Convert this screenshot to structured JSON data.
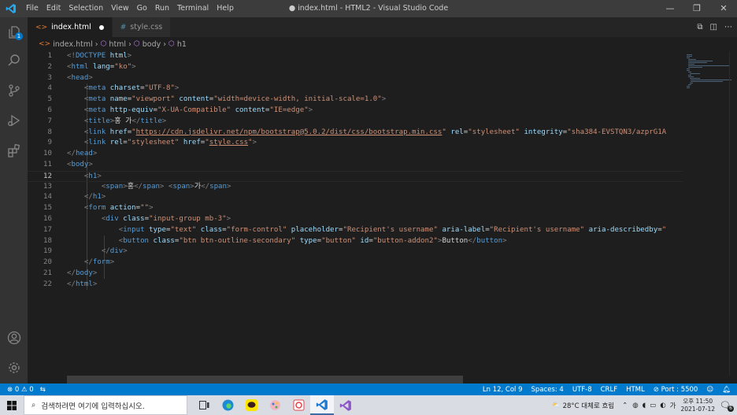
{
  "titlebar": {
    "menu": [
      "File",
      "Edit",
      "Selection",
      "View",
      "Go",
      "Run",
      "Terminal",
      "Help"
    ],
    "title": "● index.html - HTML2 - Visual Studio Code"
  },
  "activity": {
    "explorer_badge": "1"
  },
  "tabs": [
    {
      "label": "index.html",
      "icon": "<>",
      "modified": true,
      "active": true
    },
    {
      "label": "style.css",
      "icon": "#",
      "modified": false,
      "active": false
    }
  ],
  "breadcrumb": [
    "index.html",
    "html",
    "body",
    "h1"
  ],
  "editor": {
    "current_line": 12,
    "lines": [
      [
        [
          "t-br",
          "<!"
        ],
        [
          "t-tag",
          "DOCTYPE"
        ],
        [
          "t-txt",
          " "
        ],
        [
          "t-att",
          "html"
        ],
        [
          "t-br",
          ">"
        ]
      ],
      [
        [
          "t-br",
          "<"
        ],
        [
          "t-tag",
          "html"
        ],
        [
          "t-txt",
          " "
        ],
        [
          "t-att",
          "lang"
        ],
        [
          "t-txt",
          "="
        ],
        [
          "t-str",
          "\"ko\""
        ],
        [
          "t-br",
          ">"
        ]
      ],
      [
        [
          "t-br",
          "<"
        ],
        [
          "t-tag",
          "head"
        ],
        [
          "t-br",
          ">"
        ]
      ],
      [
        [
          "t-txt",
          "    "
        ],
        [
          "t-br",
          "<"
        ],
        [
          "t-tag",
          "meta"
        ],
        [
          "t-txt",
          " "
        ],
        [
          "t-att",
          "charset"
        ],
        [
          "t-txt",
          "="
        ],
        [
          "t-str",
          "\"UTF-8\""
        ],
        [
          "t-br",
          ">"
        ]
      ],
      [
        [
          "t-txt",
          "    "
        ],
        [
          "t-br",
          "<"
        ],
        [
          "t-tag",
          "meta"
        ],
        [
          "t-txt",
          " "
        ],
        [
          "t-att",
          "name"
        ],
        [
          "t-txt",
          "="
        ],
        [
          "t-str",
          "\"viewport\""
        ],
        [
          "t-txt",
          " "
        ],
        [
          "t-att",
          "content"
        ],
        [
          "t-txt",
          "="
        ],
        [
          "t-str",
          "\"width=device-width, initial-scale=1.0\""
        ],
        [
          "t-br",
          ">"
        ]
      ],
      [
        [
          "t-txt",
          "    "
        ],
        [
          "t-br",
          "<"
        ],
        [
          "t-tag",
          "meta"
        ],
        [
          "t-txt",
          " "
        ],
        [
          "t-att",
          "http-equiv"
        ],
        [
          "t-txt",
          "="
        ],
        [
          "t-str",
          "\"X-UA-Compatible\""
        ],
        [
          "t-txt",
          " "
        ],
        [
          "t-att",
          "content"
        ],
        [
          "t-txt",
          "="
        ],
        [
          "t-str",
          "\"IE=edge\""
        ],
        [
          "t-br",
          ">"
        ]
      ],
      [
        [
          "t-txt",
          "    "
        ],
        [
          "t-br",
          "<"
        ],
        [
          "t-tag",
          "title"
        ],
        [
          "t-br",
          ">"
        ],
        [
          "t-txt",
          "홍 가"
        ],
        [
          "t-br",
          "</"
        ],
        [
          "t-tag",
          "title"
        ],
        [
          "t-br",
          ">"
        ]
      ],
      [
        [
          "t-txt",
          "    "
        ],
        [
          "t-br",
          "<"
        ],
        [
          "t-tag",
          "link"
        ],
        [
          "t-txt",
          " "
        ],
        [
          "t-att",
          "href"
        ],
        [
          "t-txt",
          "="
        ],
        [
          "t-str",
          "\""
        ],
        [
          "t-link",
          "https://cdn.jsdelivr.net/npm/bootstrap@5.0.2/dist/css/bootstrap.min.css"
        ],
        [
          "t-str",
          "\""
        ],
        [
          "t-txt",
          " "
        ],
        [
          "t-att",
          "rel"
        ],
        [
          "t-txt",
          "="
        ],
        [
          "t-str",
          "\"stylesheet\""
        ],
        [
          "t-txt",
          " "
        ],
        [
          "t-att",
          "integrity"
        ],
        [
          "t-txt",
          "="
        ],
        [
          "t-str",
          "\"sha384-EVSTQN3/azprG1A"
        ]
      ],
      [
        [
          "t-txt",
          "    "
        ],
        [
          "t-br",
          "<"
        ],
        [
          "t-tag",
          "link"
        ],
        [
          "t-txt",
          " "
        ],
        [
          "t-att",
          "rel"
        ],
        [
          "t-txt",
          "="
        ],
        [
          "t-str",
          "\"stylesheet\""
        ],
        [
          "t-txt",
          " "
        ],
        [
          "t-att",
          "href"
        ],
        [
          "t-txt",
          "="
        ],
        [
          "t-str",
          "\""
        ],
        [
          "t-link",
          "style.css"
        ],
        [
          "t-str",
          "\""
        ],
        [
          "t-br",
          ">"
        ]
      ],
      [
        [
          "t-br",
          "</"
        ],
        [
          "t-tag",
          "head"
        ],
        [
          "t-br",
          ">"
        ]
      ],
      [
        [
          "t-br",
          "<"
        ],
        [
          "t-tag",
          "body"
        ],
        [
          "t-br",
          ">"
        ]
      ],
      [
        [
          "t-txt",
          "    "
        ],
        [
          "t-br",
          "<"
        ],
        [
          "t-tag",
          "h1"
        ],
        [
          "t-br",
          ">"
        ]
      ],
      [
        [
          "t-txt",
          "        "
        ],
        [
          "t-br",
          "<"
        ],
        [
          "t-tag",
          "span"
        ],
        [
          "t-br",
          ">"
        ],
        [
          "t-txt",
          "홍"
        ],
        [
          "t-br",
          "</"
        ],
        [
          "t-tag",
          "span"
        ],
        [
          "t-br",
          ">"
        ],
        [
          "t-txt",
          " "
        ],
        [
          "t-br",
          "<"
        ],
        [
          "t-tag",
          "span"
        ],
        [
          "t-br",
          ">"
        ],
        [
          "t-txt",
          "가"
        ],
        [
          "t-br",
          "</"
        ],
        [
          "t-tag",
          "span"
        ],
        [
          "t-br",
          ">"
        ]
      ],
      [
        [
          "t-txt",
          "    "
        ],
        [
          "t-br",
          "</"
        ],
        [
          "t-tag",
          "h1"
        ],
        [
          "t-br",
          ">"
        ]
      ],
      [
        [
          "t-txt",
          "    "
        ],
        [
          "t-br",
          "<"
        ],
        [
          "t-tag",
          "form"
        ],
        [
          "t-txt",
          " "
        ],
        [
          "t-att",
          "action"
        ],
        [
          "t-txt",
          "="
        ],
        [
          "t-str",
          "\"\""
        ],
        [
          "t-br",
          ">"
        ]
      ],
      [
        [
          "t-txt",
          "        "
        ],
        [
          "t-br",
          "<"
        ],
        [
          "t-tag",
          "div"
        ],
        [
          "t-txt",
          " "
        ],
        [
          "t-att",
          "class"
        ],
        [
          "t-txt",
          "="
        ],
        [
          "t-str",
          "\"input-group mb-3\""
        ],
        [
          "t-br",
          ">"
        ]
      ],
      [
        [
          "t-txt",
          "            "
        ],
        [
          "t-br",
          "<"
        ],
        [
          "t-tag",
          "input"
        ],
        [
          "t-txt",
          " "
        ],
        [
          "t-att",
          "type"
        ],
        [
          "t-txt",
          "="
        ],
        [
          "t-str",
          "\"text\""
        ],
        [
          "t-txt",
          " "
        ],
        [
          "t-att",
          "class"
        ],
        [
          "t-txt",
          "="
        ],
        [
          "t-str",
          "\"form-control\""
        ],
        [
          "t-txt",
          " "
        ],
        [
          "t-att",
          "placeholder"
        ],
        [
          "t-txt",
          "="
        ],
        [
          "t-str",
          "\"Recipient's username\""
        ],
        [
          "t-txt",
          " "
        ],
        [
          "t-att",
          "aria-label"
        ],
        [
          "t-txt",
          "="
        ],
        [
          "t-str",
          "\"Recipient's username\""
        ],
        [
          "t-txt",
          " "
        ],
        [
          "t-att",
          "aria-describedby"
        ],
        [
          "t-txt",
          "="
        ],
        [
          "t-str",
          "\""
        ]
      ],
      [
        [
          "t-txt",
          "            "
        ],
        [
          "t-br",
          "<"
        ],
        [
          "t-tag",
          "button"
        ],
        [
          "t-txt",
          " "
        ],
        [
          "t-att",
          "class"
        ],
        [
          "t-txt",
          "="
        ],
        [
          "t-str",
          "\"btn btn-outline-secondary\""
        ],
        [
          "t-txt",
          " "
        ],
        [
          "t-att",
          "type"
        ],
        [
          "t-txt",
          "="
        ],
        [
          "t-str",
          "\"button\""
        ],
        [
          "t-txt",
          " "
        ],
        [
          "t-att",
          "id"
        ],
        [
          "t-txt",
          "="
        ],
        [
          "t-str",
          "\"button-addon2\""
        ],
        [
          "t-br",
          ">"
        ],
        [
          "t-txt",
          "Button"
        ],
        [
          "t-br",
          "</"
        ],
        [
          "t-tag",
          "button"
        ],
        [
          "t-br",
          ">"
        ]
      ],
      [
        [
          "t-txt",
          "        "
        ],
        [
          "t-br",
          "</"
        ],
        [
          "t-tag",
          "div"
        ],
        [
          "t-br",
          ">"
        ]
      ],
      [
        [
          "t-txt",
          "    "
        ],
        [
          "t-br",
          "</"
        ],
        [
          "t-tag",
          "form"
        ],
        [
          "t-br",
          ">"
        ]
      ],
      [
        [
          "t-br",
          "</"
        ],
        [
          "t-tag",
          "body"
        ],
        [
          "t-br",
          ">"
        ]
      ],
      [
        [
          "t-br",
          "</"
        ],
        [
          "t-tag",
          "html"
        ],
        [
          "t-br",
          ">"
        ]
      ]
    ]
  },
  "statusbar": {
    "errors": "0",
    "warnings": "0",
    "position": "Ln 12, Col 9",
    "spaces": "Spaces: 4",
    "encoding": "UTF-8",
    "eol": "CRLF",
    "language": "HTML",
    "port": "Port : 5500"
  },
  "taskbar": {
    "search_placeholder": "검색하려면 여기에 입력하십시오.",
    "weather": "28°C  대체로 흐림",
    "time": "오후 11:50",
    "date": "2021-07-12",
    "notifications": "6",
    "ime": "가"
  },
  "colors": {
    "accent": "#007acc",
    "titlebar": "#3c3c3c",
    "editor_bg": "#1e1e1e"
  }
}
